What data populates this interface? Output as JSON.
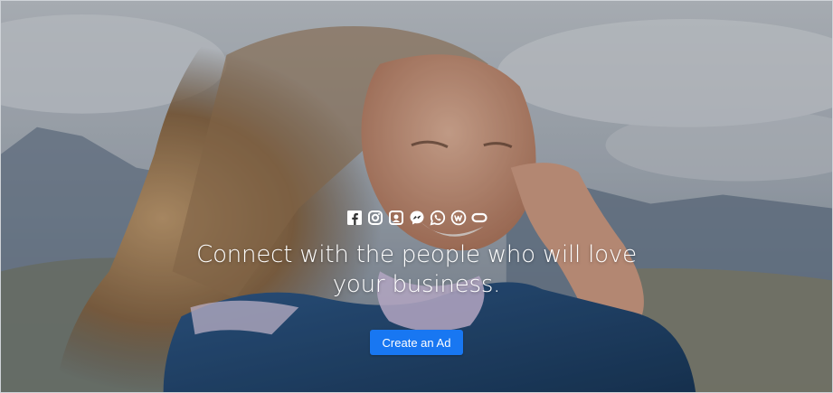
{
  "hero": {
    "headline": "Connect with the people who will love your business.",
    "cta_label": "Create an Ad",
    "platform_icons": [
      "facebook-icon",
      "instagram-icon",
      "portal-icon",
      "messenger-icon",
      "whatsapp-icon",
      "workplace-icon",
      "oculus-icon"
    ]
  },
  "colors": {
    "button": "#1877f2",
    "text": "#ffffff"
  }
}
